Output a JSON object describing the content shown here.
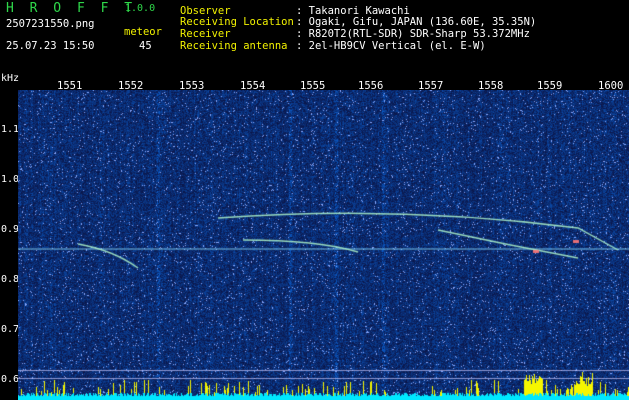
{
  "app": {
    "name": "H R O F F T",
    "version": "1.0.0"
  },
  "file": {
    "name": "2507231550.png",
    "datetime": "25.07.23 15:50"
  },
  "counter": {
    "label": "meteor",
    "value": "45"
  },
  "info": [
    {
      "label": "Observer",
      "value": ": Takanori Kawachi"
    },
    {
      "label": "Receiving Location",
      "value": ": Ogaki, Gifu, JAPAN (136.60E, 35.35N)"
    },
    {
      "label": "Receiver",
      "value": ": R820T2(RTL-SDR) SDR-Sharp 53.372MHz"
    },
    {
      "label": "Receiving antenna",
      "value": ": 2el-HB9CV Vertical (el. E-W)"
    }
  ],
  "axis": {
    "y_unit": "kHz",
    "y_ticks": [
      "1.1",
      "1.0",
      "0.9",
      "0.8",
      "0.7",
      "0.6"
    ],
    "x_ticks": [
      "1551",
      "1552",
      "1553",
      "1554",
      "1555",
      "1556",
      "1557",
      "1558",
      "1559",
      "1600"
    ]
  },
  "colors": {
    "title": "#2fd84a",
    "labels": "#f2f200",
    "text": "#ffffff",
    "background": "#000000"
  }
}
